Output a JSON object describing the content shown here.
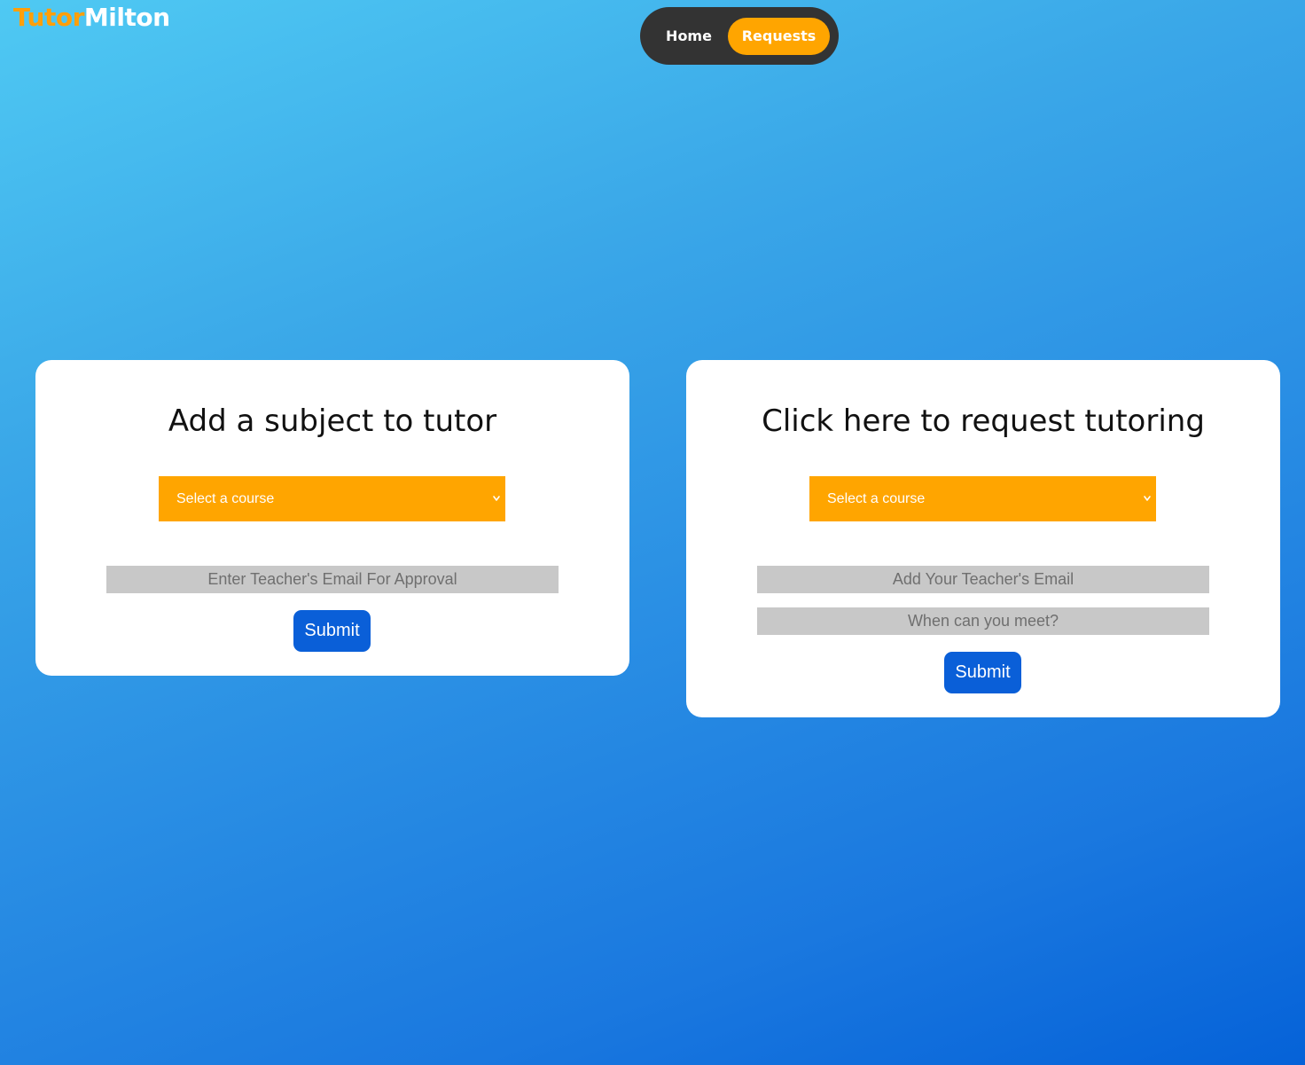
{
  "brand": {
    "part1": "Tutor",
    "part2": "Milton"
  },
  "nav": {
    "items": [
      {
        "label": "Home",
        "active": false
      },
      {
        "label": "Requests",
        "active": true
      }
    ]
  },
  "colors": {
    "accent": "#ffa500",
    "button": "#0a5fd8",
    "nav_bg": "#333333",
    "input_bg": "#c8c8c8"
  },
  "left_card": {
    "title": "Add a subject to tutor",
    "course_select": {
      "selected": "Select a course",
      "icon": "chevron-down-icon"
    },
    "email_placeholder": "Enter Teacher's Email For Approval",
    "submit_label": "Submit"
  },
  "right_card": {
    "title": "Click here to request tutoring",
    "course_select": {
      "selected": "Select a course",
      "icon": "chevron-down-icon"
    },
    "email_placeholder": "Add Your Teacher's Email",
    "meet_placeholder": "When can you meet?",
    "submit_label": "Submit"
  }
}
